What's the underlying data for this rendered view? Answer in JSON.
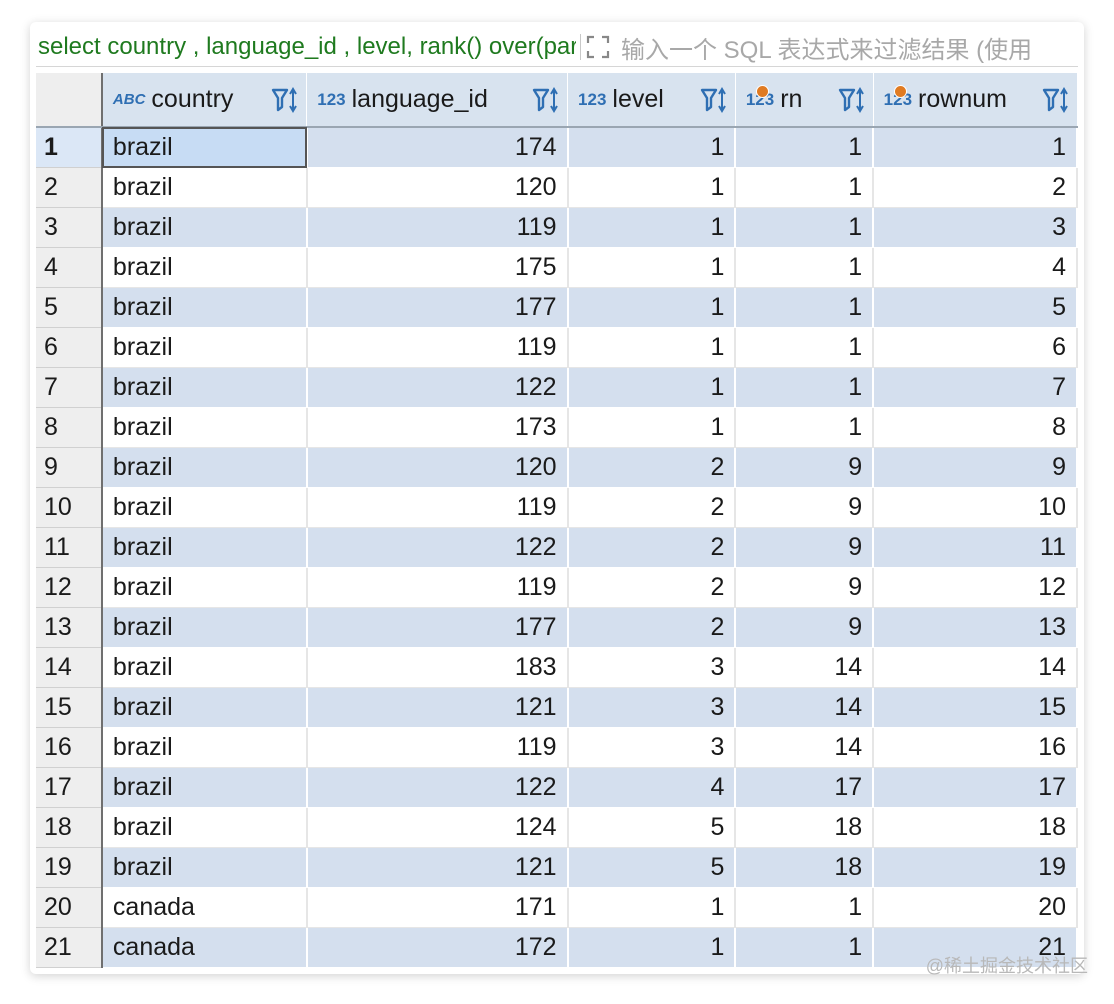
{
  "filter_bar": {
    "sql_text": "select country , language_id , level, rank() over(partition by country order by level) rn, row_number() over() rownum from t",
    "placeholder": "输入一个 SQL 表达式来过滤结果 (使用"
  },
  "columns": [
    {
      "name": "country",
      "type_badge": "ABC",
      "key": false
    },
    {
      "name": "language_id",
      "type_badge": "123",
      "key": false
    },
    {
      "name": "level",
      "type_badge": "123",
      "key": false
    },
    {
      "name": "rn",
      "type_badge": "123",
      "key": true
    },
    {
      "name": "rownum",
      "type_badge": "123",
      "key": true
    }
  ],
  "rows": [
    {
      "n": "1",
      "country": "brazil",
      "language_id": "174",
      "level": "1",
      "rn": "1",
      "rownum": "1"
    },
    {
      "n": "2",
      "country": "brazil",
      "language_id": "120",
      "level": "1",
      "rn": "1",
      "rownum": "2"
    },
    {
      "n": "3",
      "country": "brazil",
      "language_id": "119",
      "level": "1",
      "rn": "1",
      "rownum": "3"
    },
    {
      "n": "4",
      "country": "brazil",
      "language_id": "175",
      "level": "1",
      "rn": "1",
      "rownum": "4"
    },
    {
      "n": "5",
      "country": "brazil",
      "language_id": "177",
      "level": "1",
      "rn": "1",
      "rownum": "5"
    },
    {
      "n": "6",
      "country": "brazil",
      "language_id": "119",
      "level": "1",
      "rn": "1",
      "rownum": "6"
    },
    {
      "n": "7",
      "country": "brazil",
      "language_id": "122",
      "level": "1",
      "rn": "1",
      "rownum": "7"
    },
    {
      "n": "8",
      "country": "brazil",
      "language_id": "173",
      "level": "1",
      "rn": "1",
      "rownum": "8"
    },
    {
      "n": "9",
      "country": "brazil",
      "language_id": "120",
      "level": "2",
      "rn": "9",
      "rownum": "9"
    },
    {
      "n": "10",
      "country": "brazil",
      "language_id": "119",
      "level": "2",
      "rn": "9",
      "rownum": "10"
    },
    {
      "n": "11",
      "country": "brazil",
      "language_id": "122",
      "level": "2",
      "rn": "9",
      "rownum": "11"
    },
    {
      "n": "12",
      "country": "brazil",
      "language_id": "119",
      "level": "2",
      "rn": "9",
      "rownum": "12"
    },
    {
      "n": "13",
      "country": "brazil",
      "language_id": "177",
      "level": "2",
      "rn": "9",
      "rownum": "13"
    },
    {
      "n": "14",
      "country": "brazil",
      "language_id": "183",
      "level": "3",
      "rn": "14",
      "rownum": "14"
    },
    {
      "n": "15",
      "country": "brazil",
      "language_id": "121",
      "level": "3",
      "rn": "14",
      "rownum": "15"
    },
    {
      "n": "16",
      "country": "brazil",
      "language_id": "119",
      "level": "3",
      "rn": "14",
      "rownum": "16"
    },
    {
      "n": "17",
      "country": "brazil",
      "language_id": "122",
      "level": "4",
      "rn": "17",
      "rownum": "17"
    },
    {
      "n": "18",
      "country": "brazil",
      "language_id": "124",
      "level": "5",
      "rn": "18",
      "rownum": "18"
    },
    {
      "n": "19",
      "country": "brazil",
      "language_id": "121",
      "level": "5",
      "rn": "18",
      "rownum": "19"
    },
    {
      "n": "20",
      "country": "canada",
      "language_id": "171",
      "level": "1",
      "rn": "1",
      "rownum": "20"
    },
    {
      "n": "21",
      "country": "canada",
      "language_id": "172",
      "level": "1",
      "rn": "1",
      "rownum": "21"
    }
  ],
  "watermark": "@稀土掘金技术社区",
  "colors": {
    "accent": "#2f6fb3",
    "sql_text": "#1f7a1f",
    "odd_row": "#d4dfee",
    "key_dot": "#e07b22"
  }
}
